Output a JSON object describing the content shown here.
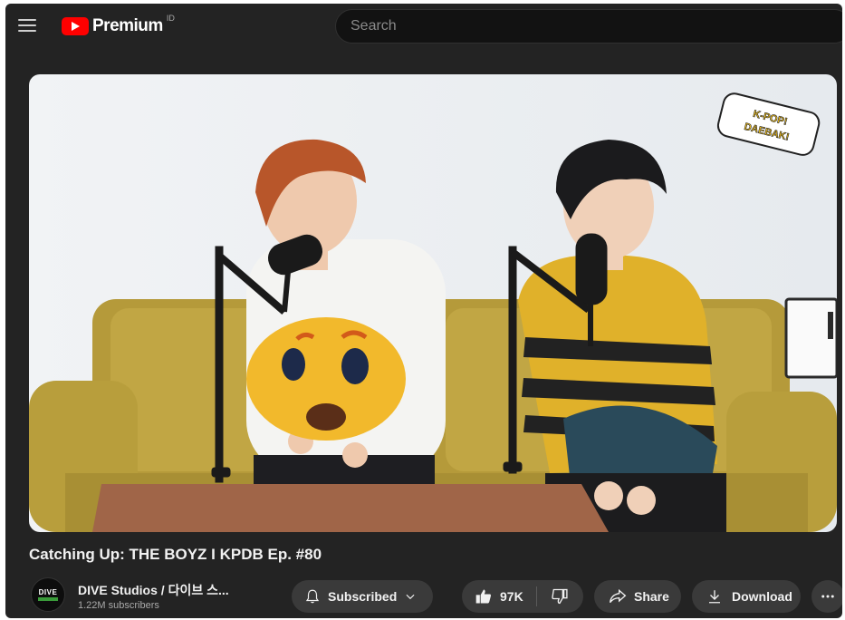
{
  "header": {
    "logo_text": "Premium",
    "region": "ID",
    "search_placeholder": "Search",
    "icons": {
      "menu": "hamburger-menu-icon",
      "logo": "youtube-logo-icon"
    }
  },
  "video": {
    "title": "Catching Up: THE BOYZ I KPDB Ep. #80",
    "watermark_text": "K-POP! DAEBAK!"
  },
  "channel": {
    "avatar_text": "DIVE",
    "name": "DIVE Studios / 다이브 스...",
    "subscribers": "1.22M subscribers"
  },
  "actions": {
    "subscribed_label": "Subscribed",
    "like_count": "97K",
    "share_label": "Share",
    "download_label": "Download"
  },
  "colors": {
    "brand_red": "#ff0000",
    "background": "#232323",
    "pill": "#3a3a3a",
    "text": "#f1f1f1",
    "muted": "#aaaaaa"
  }
}
